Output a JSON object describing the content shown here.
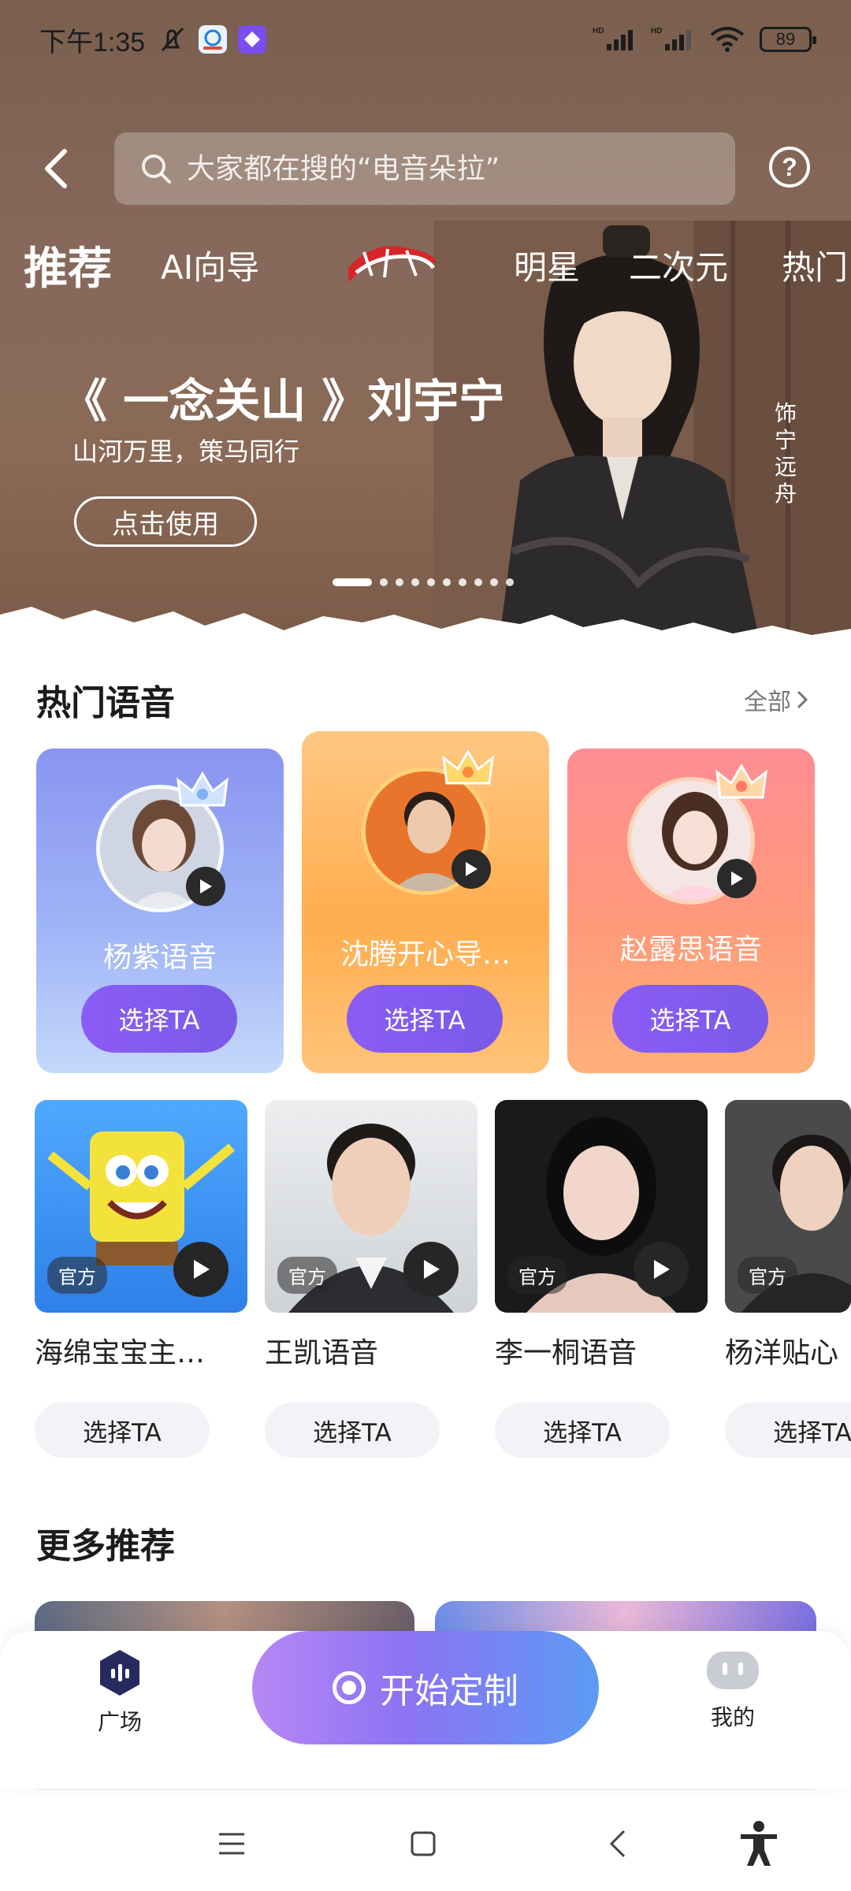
{
  "status_bar": {
    "time": "下午1:35",
    "battery": "89"
  },
  "search": {
    "placeholder": "大家都在搜的“电音朵拉”"
  },
  "tabs": [
    {
      "label": "推荐",
      "active": true
    },
    {
      "label": "AI向导",
      "active": false
    },
    {
      "label": "明星",
      "active": false
    },
    {
      "label": "二次元",
      "active": false
    },
    {
      "label": "热门",
      "active": false
    }
  ],
  "banner": {
    "title": "《 一念关山 》刘宇宁",
    "subtitle": "山河万里，策马同行",
    "cta": "点击使用",
    "vertical_caption": "饰宁远舟",
    "page_count": 10,
    "active_page": 1
  },
  "hot_voices": {
    "title": "热门语音",
    "see_all": "全部",
    "featured": [
      {
        "name": "杨紫语音",
        "button": "选择TA",
        "theme": "blue"
      },
      {
        "name": "沈腾开心导…",
        "button": "选择TA",
        "theme": "orange"
      },
      {
        "name": "赵露思语音",
        "button": "选择TA",
        "theme": "pink"
      }
    ],
    "list": [
      {
        "name": "海绵宝宝主…",
        "tag": "官方",
        "button": "选择TA"
      },
      {
        "name": "王凯语音",
        "tag": "官方",
        "button": "选择TA"
      },
      {
        "name": "李一桐语音",
        "tag": "官方",
        "button": "选择TA"
      },
      {
        "name": "杨洋贴心",
        "tag": "官方",
        "button": "选择TA"
      }
    ]
  },
  "more": {
    "title": "更多推荐"
  },
  "bottom_nav": {
    "plaza": "广场",
    "start": "开始定制",
    "mine": "我的"
  },
  "colors": {
    "hero_bg": "#7f6150",
    "accent_purple": "#8b5cf6",
    "card_blue": "#8fa9f2",
    "card_orange": "#ffb45e",
    "card_pink": "#ff8f86"
  }
}
